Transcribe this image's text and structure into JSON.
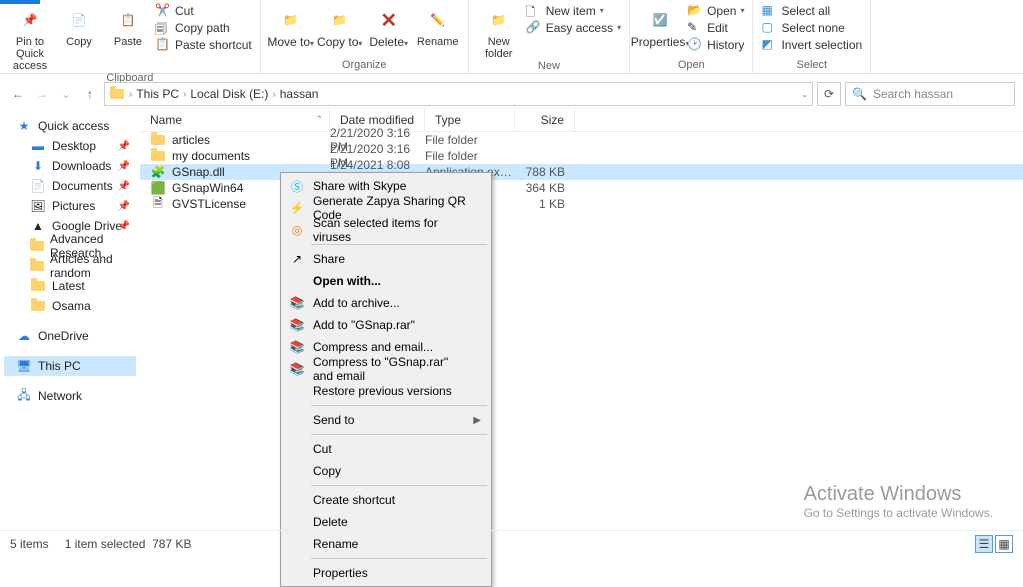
{
  "ribbon": {
    "pin": "Pin to Quick access",
    "copy": "Copy",
    "paste": "Paste",
    "cut": "Cut",
    "copy_path": "Copy path",
    "paste_shortcut": "Paste shortcut",
    "clipboard": "Clipboard",
    "move_to": "Move to",
    "copy_to": "Copy to",
    "delete": "Delete",
    "rename": "Rename",
    "organize": "Organize",
    "new_folder": "New folder",
    "new_item": "New item",
    "easy_access": "Easy access",
    "new": "New",
    "properties": "Properties",
    "open_btn": "Open",
    "edit": "Edit",
    "history": "History",
    "open": "Open",
    "select_all": "Select all",
    "select_none": "Select none",
    "invert": "Invert selection",
    "select": "Select"
  },
  "breadcrumb": {
    "pc": "This PC",
    "disk": "Local Disk (E:)",
    "folder": "hassan"
  },
  "search": {
    "placeholder": "Search hassan"
  },
  "sidebar": {
    "quick": "Quick access",
    "desktop": "Desktop",
    "downloads": "Downloads",
    "documents": "Documents",
    "pictures": "Pictures",
    "gdrive": "Google Drive",
    "adv": "Advanced Research",
    "art": "Articles and random",
    "latest": "Latest",
    "osama": "Osama",
    "onedrive": "OneDrive",
    "thispc": "This PC",
    "network": "Network"
  },
  "columns": {
    "name": "Name",
    "date": "Date modified",
    "type": "Type",
    "size": "Size"
  },
  "files": [
    {
      "name": "articles",
      "date": "2/21/2020 3:16 PM",
      "type": "File folder",
      "size": ""
    },
    {
      "name": "my documents",
      "date": "2/21/2020 3:16 PM",
      "type": "File folder",
      "size": ""
    },
    {
      "name": "GSnap.dll",
      "date": "1/24/2021 8:08 PM",
      "type": "Application exten...",
      "size": "788 KB"
    },
    {
      "name": "GSnapWin64",
      "date": "",
      "type": "",
      "size": "364 KB"
    },
    {
      "name": "GVSTLicense",
      "date": "",
      "type": "",
      "size": "1 KB"
    }
  ],
  "ctx": {
    "skype": "Share with Skype",
    "zapya": "Generate Zapya Sharing QR Code",
    "scan": "Scan selected items for viruses",
    "share": "Share",
    "openwith": "Open with...",
    "add_archive": "Add to archive...",
    "add_rar": "Add to \"GSnap.rar\"",
    "compress_email": "Compress and email...",
    "compress_rar_email": "Compress to \"GSnap.rar\" and email",
    "restore": "Restore previous versions",
    "sendto": "Send to",
    "cut": "Cut",
    "copy": "Copy",
    "shortcut": "Create shortcut",
    "delete": "Delete",
    "rename": "Rename",
    "properties": "Properties"
  },
  "status": {
    "count": "5 items",
    "selected": "1 item selected",
    "size": "787 KB"
  },
  "watermark": {
    "t1": "Activate Windows",
    "t2": "Go to Settings to activate Windows."
  }
}
